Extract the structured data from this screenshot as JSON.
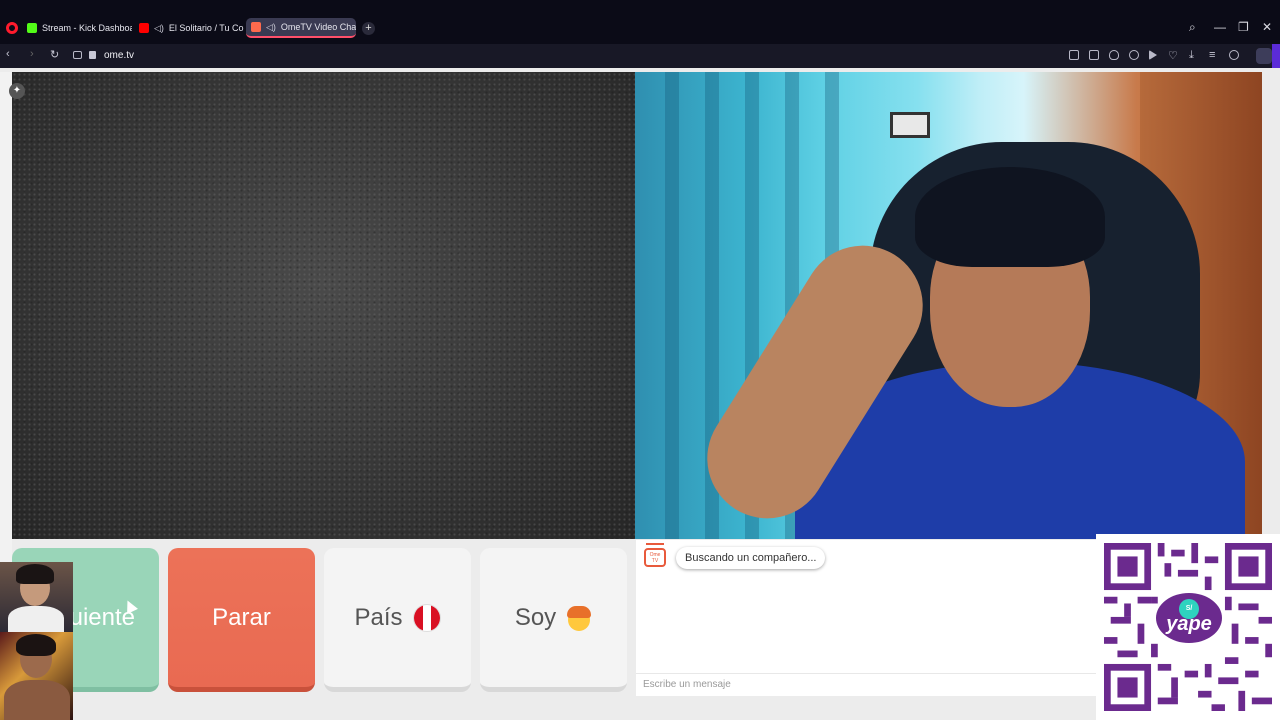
{
  "browser": {
    "tabs": [
      {
        "label": "Stream - Kick Dashboard",
        "icon": "kick-icon",
        "color": "#53fc18"
      },
      {
        "label": "El Solitario / Tu Conce",
        "icon": "youtube-icon",
        "color": "#ff0000"
      },
      {
        "label": "OmeTV Video Chat -",
        "icon": "ometv-icon",
        "color": "#ff6a4d",
        "active": true
      }
    ],
    "url": "ome.tv"
  },
  "controls": {
    "next_label": "uiente",
    "stop_label": "Parar",
    "country_label": "País",
    "iam_label": "Soy"
  },
  "chat": {
    "logo_text": "Ome TV",
    "status_message": "Buscando un compañero...",
    "input_placeholder": "Escribe un mensaje"
  },
  "donation": {
    "brand": "yape",
    "coin": "S/"
  },
  "colors": {
    "stop": "#e96a52",
    "next": "#99d5b8",
    "brand_accent": "#ff4f6a",
    "yape_purple": "#6b2a8e"
  }
}
